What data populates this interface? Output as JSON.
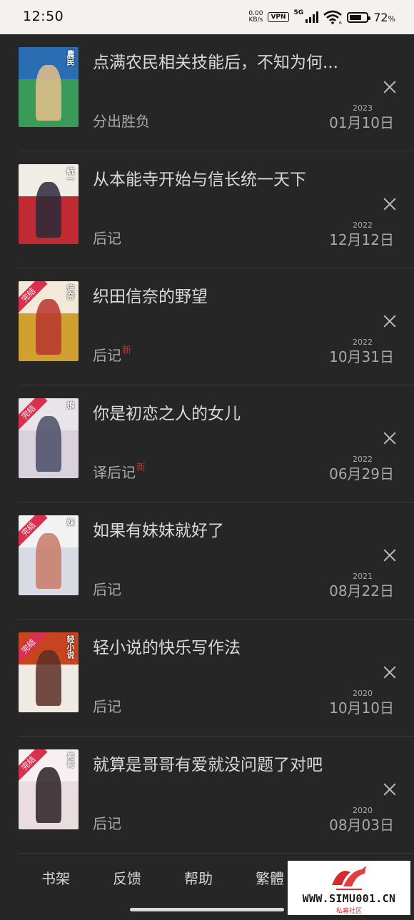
{
  "status": {
    "time": "12:50",
    "net_speed_value": "0.00",
    "net_speed_unit": "KB/s",
    "vpn": "VPN",
    "network": "5G",
    "wifi_sub": "6",
    "battery_value": "72",
    "battery_unit": "%",
    "battery_level": 0.72
  },
  "books": [
    {
      "title": "点满农民相关技能后，不知为何...",
      "chapter": "分出胜负",
      "new_badge": "",
      "year": "2023",
      "date": "01月10日",
      "cover": {
        "top": "#2a6db3",
        "bottom": "#3a9a5a",
        "figure": "#e7c08a",
        "ribbon": "",
        "text": "農民"
      }
    },
    {
      "title": "从本能寺开始与信长统一天下",
      "chapter": "后记",
      "new_badge": "",
      "year": "2022",
      "date": "12月12日",
      "cover": {
        "top": "#f0ece6",
        "bottom": "#c22a33",
        "figure": "#2a2a3a",
        "ribbon": "",
        "text": "統一"
      }
    },
    {
      "title": "织田信奈的野望",
      "chapter": "后记",
      "new_badge": "新",
      "year": "2022",
      "date": "10月31日",
      "cover": {
        "top": "#f3e9d8",
        "bottom": "#d0a030",
        "figure": "#b8352f",
        "ribbon": "完结",
        "text": "信奈"
      }
    },
    {
      "title": "你是初恋之人的女儿",
      "chapter": "译后记",
      "new_badge": "新",
      "year": "2022",
      "date": "06月29日",
      "cover": {
        "top": "#e9e4ea",
        "bottom": "#d9d2dc",
        "figure": "#4a4e66",
        "ribbon": "完结",
        "text": "娘"
      }
    },
    {
      "title": "如果有妹妹就好了",
      "chapter": "后记",
      "new_badge": "",
      "year": "2021",
      "date": "08月22日",
      "cover": {
        "top": "#f2f2f2",
        "bottom": "#d8dbe3",
        "figure": "#c97a6a",
        "ribbon": "完结",
        "text": "妹"
      }
    },
    {
      "title": "轻小说的快乐写作法",
      "chapter": "后记",
      "new_badge": "",
      "year": "2020",
      "date": "10月10日",
      "cover": {
        "top": "#c8431f",
        "bottom": "#f0ebe2",
        "figure": "#5a2f26",
        "ribbon": "完结",
        "text": "轻小说"
      }
    },
    {
      "title": "就算是哥哥有爱就没问题了对吧",
      "chapter": "后记",
      "new_badge": "",
      "year": "2020",
      "date": "08月03日",
      "cover": {
        "top": "#f7f0f2",
        "bottom": "#e9dde0",
        "figure": "#2a1f26",
        "ribbon": "完结",
        "text": "哥哥"
      }
    }
  ],
  "nav": {
    "bookshelf": "书架",
    "feedback": "反馈",
    "help": "帮助",
    "traditional": "繁體"
  },
  "watermark": {
    "url": "WWW.SIMU001.CN",
    "sub": "私募社区"
  }
}
